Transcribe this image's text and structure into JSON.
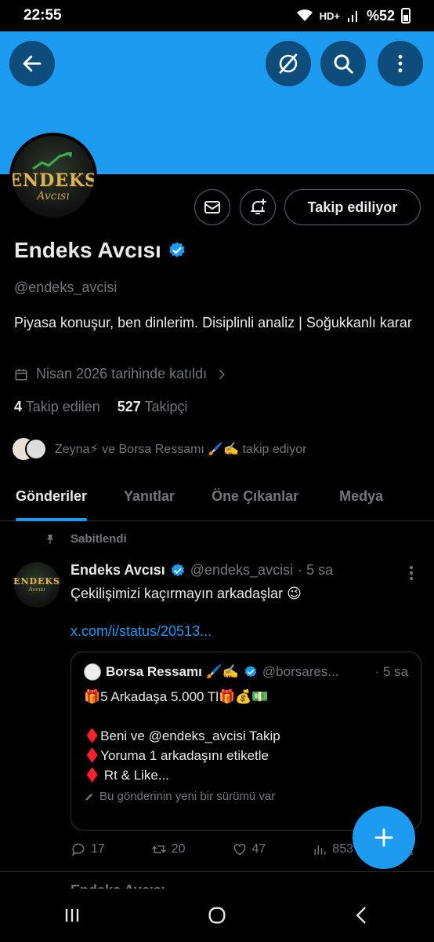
{
  "status_bar": {
    "time": "22:55",
    "network": "HD+",
    "battery": "%52"
  },
  "header": {
    "icons": [
      "back-arrow-icon",
      "grok-icon",
      "search-icon",
      "more-vertical-icon"
    ]
  },
  "profile": {
    "avatar_logo": "ENDEKS",
    "avatar_logo_sub": "Avcısı",
    "follow_button_label": "Takip ediliyor",
    "name": "Endeks Avcısı",
    "handle": "@endeks_avcisi",
    "bio": "Piyasa konuşur, ben dinlerim. Disiplinli analiz | Soğukkanlı karar",
    "joined": "Nisan 2026 tarihinde katıldı",
    "following_count": "4",
    "following_label": "Takip edilen",
    "followers_count": "527",
    "followers_label": "Takipçi",
    "followed_by": "Zeyna⚡ ve Borsa Ressamı 🖌️✍️ takip ediyor"
  },
  "tabs": [
    {
      "label": "Gönderiler",
      "active": true
    },
    {
      "label": "Yanıtlar",
      "active": false
    },
    {
      "label": "Öne Çıkanlar",
      "active": false
    },
    {
      "label": "Medya",
      "active": false
    }
  ],
  "pinned_post": {
    "pinned_label": "Sabitlendi",
    "author": "Endeks Avcısı",
    "handle": "@endeks_avcisi",
    "time": "· 5 sa",
    "text": "Çekilişimizi kaçırmayın arkadaşlar 😉",
    "link": "x.com/i/status/20513...",
    "quote": {
      "author": "Borsa Ressamı 🖌️✍️",
      "handle": "@borsares...",
      "time": "· 5 sa",
      "line1": "🎁5 Arkadaşa 5.000 Tl🎁💰💵",
      "line2": "♦️Beni ve @endeks_avcisi Takip",
      "line3": "♦️Yoruma  1 arkadaşını etiketle",
      "line4": "♦️ Rt & Like...",
      "note": "Bu gönderinin yeni bir sürümü var"
    },
    "actions": {
      "replies": "17",
      "reposts": "20",
      "likes": "47",
      "views": "853"
    }
  },
  "next_post_peek": "Endeks Avcısı",
  "colors": {
    "accent": "#1d9bf0",
    "banner": "#1d9bf0",
    "background": "#000000",
    "muted": "#71767b"
  }
}
